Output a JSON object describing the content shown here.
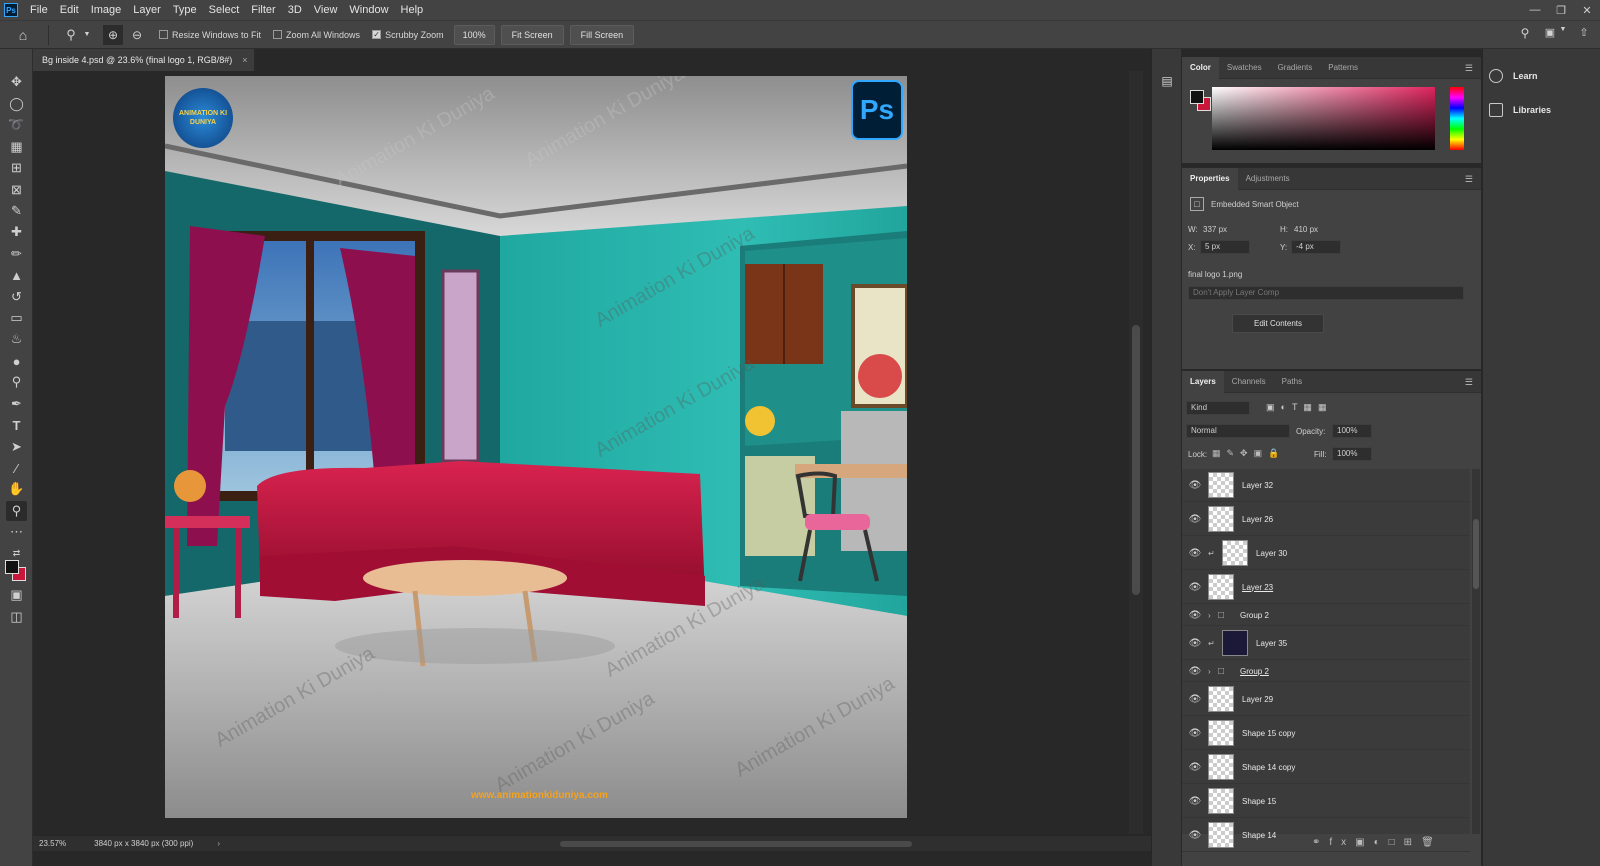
{
  "app": {
    "logo": "Ps"
  },
  "menu": [
    "File",
    "Edit",
    "Image",
    "Layer",
    "Type",
    "Select",
    "Filter",
    "3D",
    "View",
    "Window",
    "Help"
  ],
  "options": {
    "resize_windows": "Resize Windows to Fit",
    "zoom_all": "Zoom All Windows",
    "scrubby_zoom": "Scrubby Zoom",
    "zoom_value": "100%",
    "fit_screen": "Fit Screen",
    "fill_screen": "Fill Screen"
  },
  "document": {
    "tab_title": "Bg inside 4.psd @ 23.6% (final logo 1, RGB/8#)",
    "tab_close": "×"
  },
  "canvas": {
    "ps_badge": "Ps",
    "logo_text": "ANIMATION KI DUNIYA",
    "watermark": "Animation Ki Duniya",
    "website": "www.animationkiduniya.com"
  },
  "status": {
    "zoom": "23.57%",
    "size": "3840 px x 3840 px (300 ppi)"
  },
  "color_panel": {
    "tabs": [
      "Color",
      "Swatches",
      "Gradients",
      "Patterns"
    ],
    "fg": "#111111",
    "bg": "#c8173a"
  },
  "properties": {
    "tabs": [
      "Properties",
      "Adjustments"
    ],
    "type": "Embedded Smart Object",
    "w_label": "W:",
    "w": "337 px",
    "h_label": "H:",
    "h": "410 px",
    "x_label": "X:",
    "x": "5 px",
    "y_label": "Y:",
    "y": "-4 px",
    "filename": "final logo 1.png",
    "layer_comp": "Don't Apply Layer Comp",
    "edit_contents": "Edit Contents"
  },
  "layers_panel": {
    "tabs": [
      "Layers",
      "Channels",
      "Paths"
    ],
    "kind": "Kind",
    "blend": "Normal",
    "opacity_label": "Opacity:",
    "opacity": "100%",
    "lock_label": "Lock:",
    "fill_label": "Fill:",
    "fill": "100%",
    "layers": [
      {
        "name": "Layer 32"
      },
      {
        "name": "Layer 26"
      },
      {
        "name": "Layer 30"
      },
      {
        "name": "Layer 23"
      },
      {
        "name": "Group 2"
      },
      {
        "name": "Layer 35"
      },
      {
        "name": "Group 2"
      },
      {
        "name": "Layer 29"
      },
      {
        "name": "Shape 15 copy"
      },
      {
        "name": "Shape 14 copy"
      },
      {
        "name": "Shape 15"
      },
      {
        "name": "Shape 14"
      }
    ]
  },
  "far_right": {
    "learn": "Learn",
    "libraries": "Libraries"
  }
}
